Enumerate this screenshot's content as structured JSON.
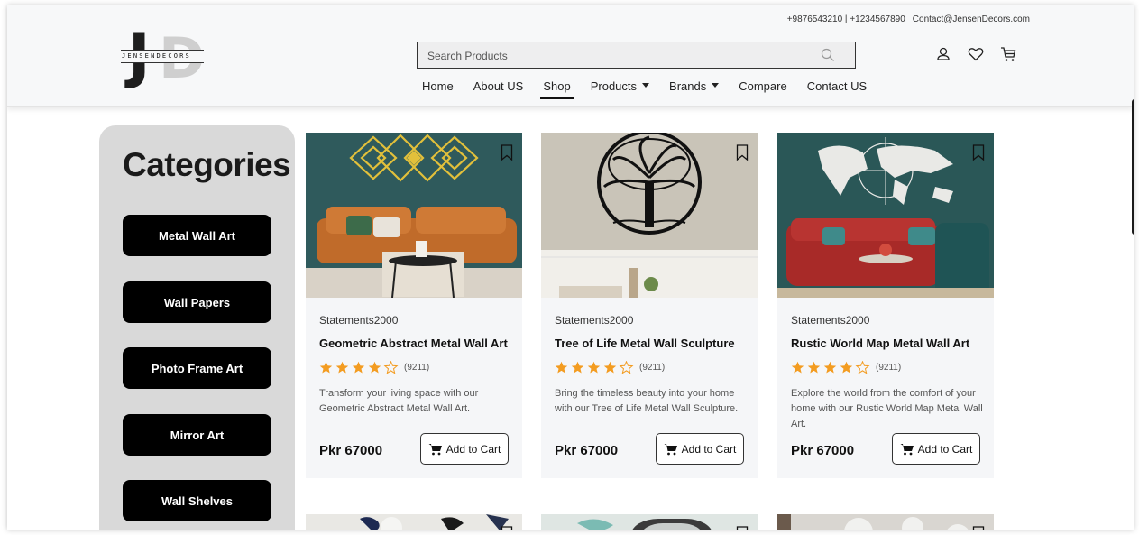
{
  "header": {
    "logo_word": "JENSENDECORS",
    "phone": "+9876543210 | +1234567890",
    "email": "Contact@JensenDecors.com",
    "search_placeholder": "Search Products"
  },
  "nav": {
    "home": "Home",
    "about": "About US",
    "shop": "Shop",
    "products": "Products",
    "brands": "Brands",
    "compare": "Compare",
    "contact": "Contact US"
  },
  "sidebar": {
    "title": "Categories",
    "items": [
      "Metal Wall Art",
      "Wall Papers",
      "Photo Frame Art",
      "Mirror Art",
      "Wall Shelves"
    ]
  },
  "products": [
    {
      "brand": "Statements2000",
      "title": "Geometric Abstract Metal Wall Art",
      "rating_count": "(9211)",
      "rating": 4.5,
      "description": "Transform your living space with our Geometric Abstract Metal Wall Art.",
      "price": "Pkr 67000",
      "cart_label": "Add to Cart"
    },
    {
      "brand": "Statements2000",
      "title": "Tree of Life Metal Wall Sculpture",
      "rating_count": "(9211)",
      "rating": 4.5,
      "description": "Bring the timeless beauty into your home with our Tree of Life Metal Wall Sculpture.",
      "price": "Pkr 67000",
      "cart_label": "Add to Cart"
    },
    {
      "brand": "Statements2000",
      "title": "Rustic World Map Metal Wall Art",
      "rating_count": "(9211)",
      "rating": 4.5,
      "description": "Explore the world from the comfort of your home with our Rustic World Map Metal Wall Art.",
      "price": "Pkr 67000",
      "cart_label": "Add to Cart"
    }
  ],
  "colors": {
    "star": "#f39c21",
    "button_bg": "#000000",
    "sidebar_bg": "#d9d9d9"
  }
}
